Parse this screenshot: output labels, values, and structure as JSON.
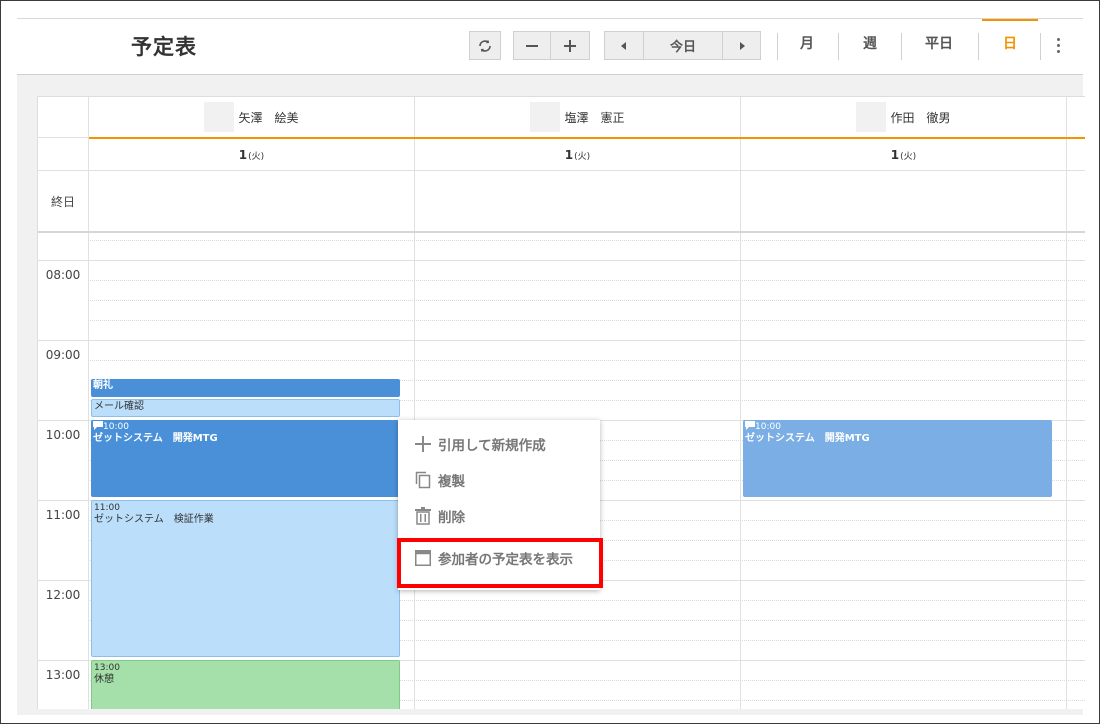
{
  "header": {
    "title": "予定表",
    "today_label": "今日",
    "views": [
      {
        "label": "月",
        "active": false
      },
      {
        "label": "週",
        "active": false
      },
      {
        "label": "平日",
        "active": false
      },
      {
        "label": "日",
        "active": true
      }
    ],
    "accent_color": "#f29400"
  },
  "calendar": {
    "allday_label": "終日",
    "users": [
      {
        "name": "矢澤　絵美",
        "date": "1",
        "weekday": "(火)"
      },
      {
        "name": "塩澤　憲正",
        "date": "1",
        "weekday": "(火)"
      },
      {
        "name": "作田　徹男",
        "date": "1",
        "weekday": "(火)"
      }
    ],
    "hours": [
      "08:00",
      "09:00",
      "10:00",
      "11:00",
      "12:00",
      "13:00"
    ]
  },
  "events": {
    "chorei": {
      "name": "朝礼"
    },
    "mail": {
      "name": "メール確認"
    },
    "mtg1": {
      "time": "10:00",
      "name": "ゼットシステム　開発MTG"
    },
    "kensho": {
      "time": "11:00",
      "name": "ゼットシステム　検証作業"
    },
    "kyukei": {
      "time": "13:00",
      "name": "休憩"
    },
    "mtg2": {
      "time": "10:00",
      "name": "ゼットシステム　開発MTG"
    }
  },
  "context_menu": {
    "items": [
      {
        "label": "引用して新規作成",
        "icon": "plus-icon"
      },
      {
        "label": "複製",
        "icon": "copy-icon"
      },
      {
        "label": "削除",
        "icon": "trash-icon"
      },
      {
        "label": "参加者の予定表を表示",
        "icon": "window-icon",
        "highlighted": true
      }
    ]
  },
  "colors": {
    "event_dark": "#4a90d9",
    "event_light": "#bbdefb",
    "event_mid": "#7aaee4",
    "event_green": "#a5dfa9",
    "highlight": "#ff0000"
  }
}
